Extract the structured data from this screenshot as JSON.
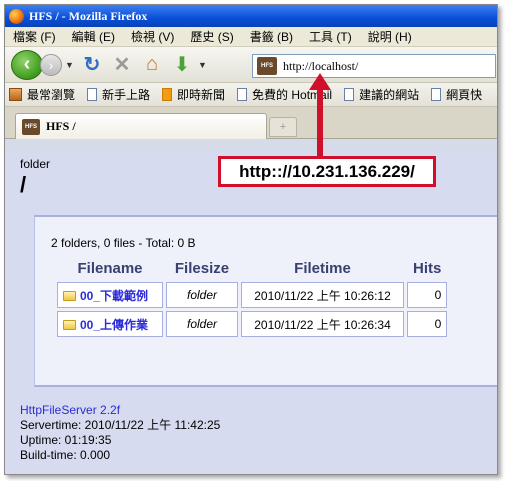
{
  "window": {
    "title": "HFS / - Mozilla Firefox"
  },
  "menu": [
    "檔案 (F)",
    "編輯 (E)",
    "檢視 (V)",
    "歷史 (S)",
    "書籤 (B)",
    "工具 (T)",
    "說明 (H)"
  ],
  "navbar": {
    "url": "http://localhost/",
    "site_icon_text": "HFS"
  },
  "bookmarks": [
    "最常瀏覽",
    "新手上路",
    "即時新聞",
    "免費的 Hotmail",
    "建議的網站",
    "網頁快"
  ],
  "tab": {
    "label": "HFS /",
    "icon_text": "HFS",
    "new_tab_label": "+"
  },
  "page": {
    "folder_label": "folder",
    "folder_path": "/",
    "summary": "2 folders, 0 files - Total: 0 B",
    "columns": [
      "Filename",
      "Filesize",
      "Filetime",
      "Hits"
    ],
    "rows": [
      {
        "name": "00_下載範例",
        "size": "folder",
        "time": "2010/11/22 上午 10:26:12",
        "hits": "0"
      },
      {
        "name": "00_上傳作業",
        "size": "folder",
        "time": "2010/11/22 上午 10:26:34",
        "hits": "0"
      }
    ],
    "footer": {
      "server_name": "HttpFileServer 2.2f",
      "servertime": "Servertime: 2010/11/22 上午 11:42:25",
      "uptime": "Uptime: 01:19:35",
      "buildtime": "Build-time: 0.000"
    }
  },
  "annotation": {
    "text": "http:://10.231.136.229/",
    "color": "#d0102a"
  }
}
